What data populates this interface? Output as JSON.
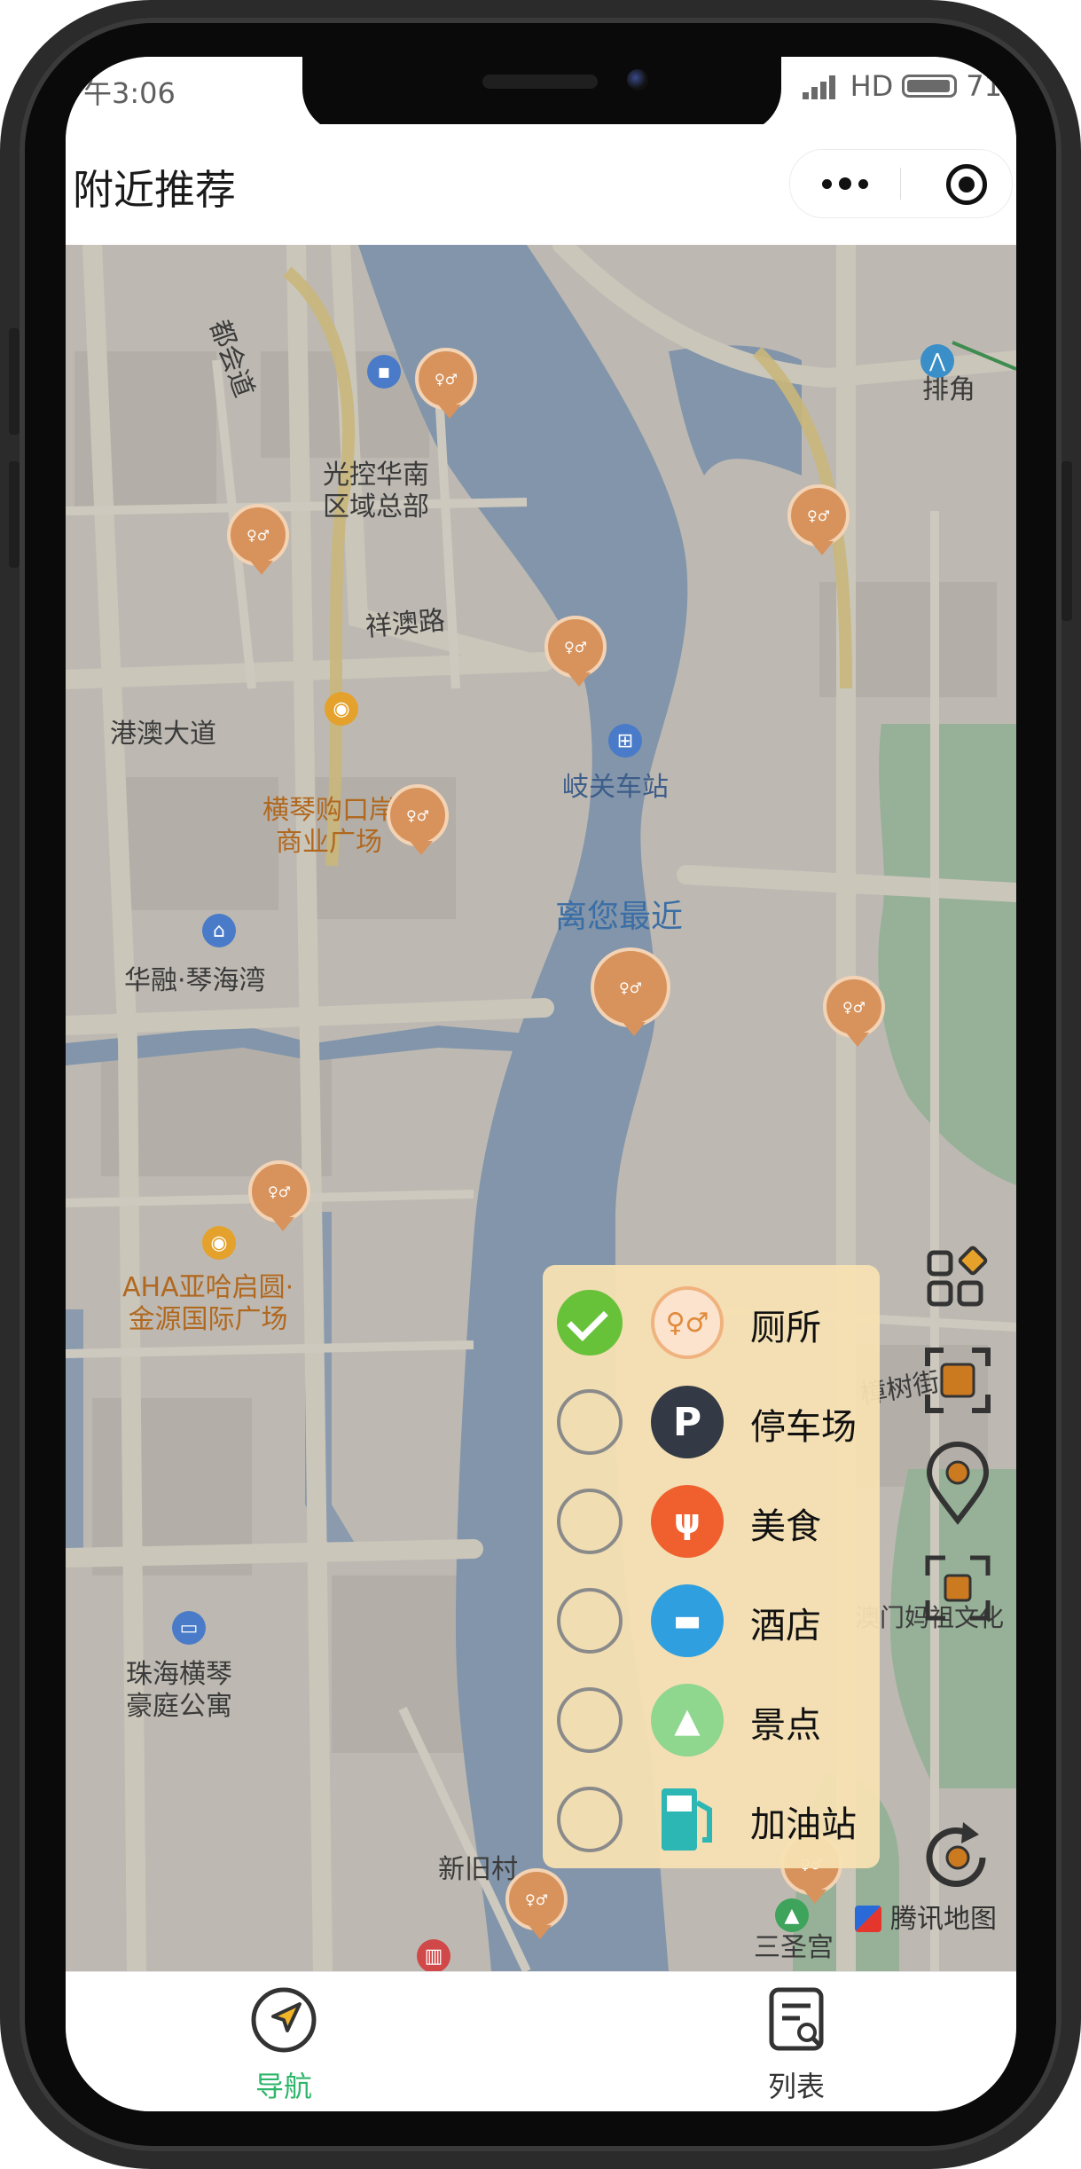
{
  "status_bar": {
    "time": "午3:06",
    "network": "HD",
    "battery": "71"
  },
  "header": {
    "title": "附近推荐"
  },
  "map": {
    "labels": {
      "dugong_road": "都会道",
      "guangkong": "光控华南\n区域总部",
      "xiangao_road": "祥澳路",
      "gangao_avenue": "港澳大道",
      "qiguan_station": "岐关车站",
      "hengqin_port": "横琴购口岸\n商业广场",
      "nearest": "离您最近",
      "huarong": "华融·琴海湾",
      "aha_plaza": "AHA亚哈启圆·\n金源国际广场",
      "zhuhai_court": "珠海横琴\n豪庭公寓",
      "xinjiu_village": "新旧村",
      "sansheng_palace": "三圣宫",
      "tencent_map": "腾讯地图",
      "paijiao": "排角",
      "zhangshu": "樟树街",
      "mazu_temple": "澳门妈祖文化"
    }
  },
  "filter": {
    "items": [
      {
        "label": "厕所",
        "checked": true,
        "icon": "toilet-icon",
        "color": "#f5c9a3"
      },
      {
        "label": "停车场",
        "checked": false,
        "icon": "parking-icon",
        "color": "#333a45"
      },
      {
        "label": "美食",
        "checked": false,
        "icon": "food-icon",
        "color": "#f0602f"
      },
      {
        "label": "酒店",
        "checked": false,
        "icon": "hotel-icon",
        "color": "#2f9fe0"
      },
      {
        "label": "景点",
        "checked": false,
        "icon": "scenic-icon",
        "color": "#8fd68f"
      },
      {
        "label": "加油站",
        "checked": false,
        "icon": "gas-station-icon",
        "color": "#2cb6b4"
      }
    ]
  },
  "tabs": [
    {
      "label": "导航",
      "active": true,
      "icon": "navigation-icon",
      "color": "#2fb56a"
    },
    {
      "label": "列表",
      "active": false,
      "icon": "list-icon",
      "color": "#333333"
    }
  ]
}
